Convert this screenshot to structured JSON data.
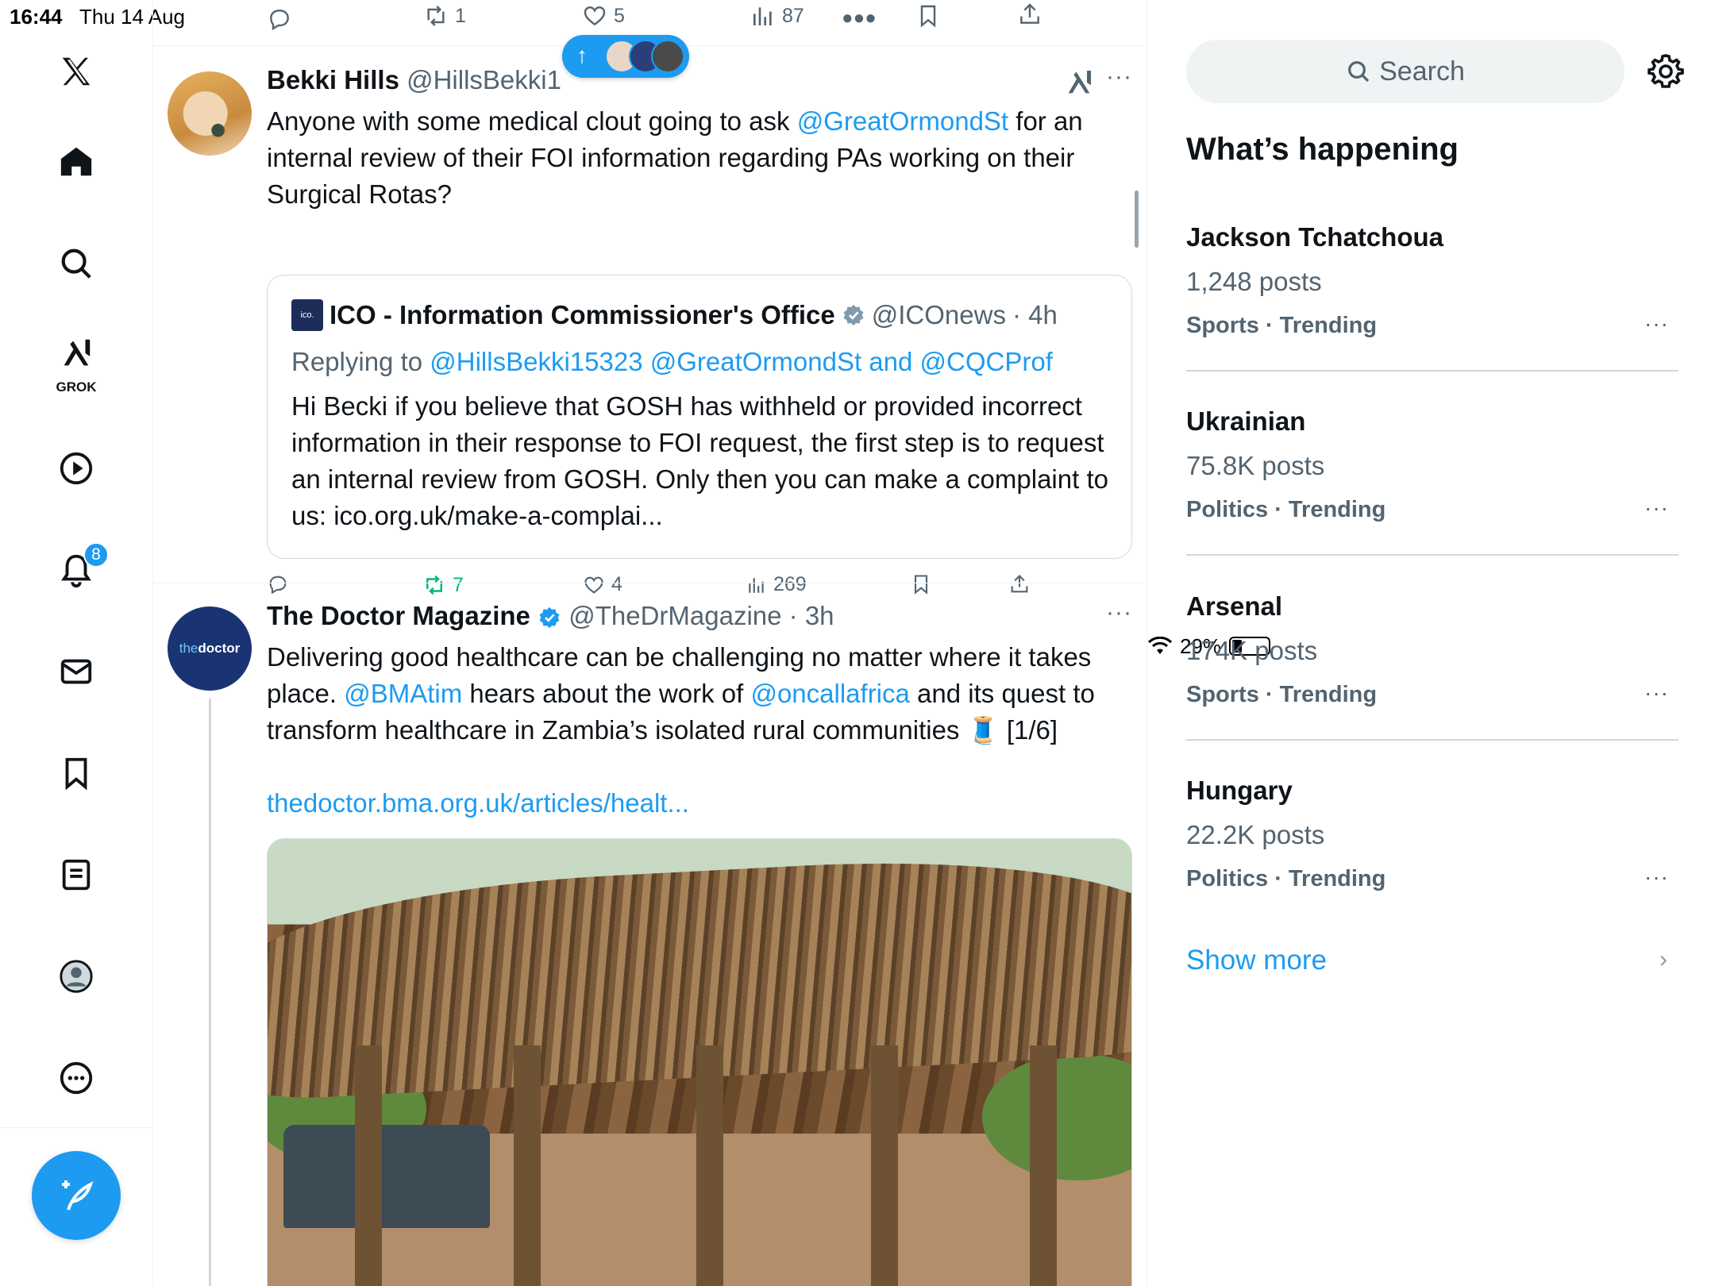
{
  "status": {
    "time": "16:44",
    "date": "Thu 14 Aug",
    "battery": "29%"
  },
  "nav": {
    "grok_label": "GROK",
    "notifications_badge": "8",
    "items": [
      "x-logo-icon",
      "home-icon",
      "search-icon",
      "grok-icon",
      "video-icon",
      "bell-icon",
      "mail-icon",
      "bookmark-icon",
      "lists-icon",
      "profile-icon",
      "more-icon"
    ]
  },
  "top_actions": {
    "retweets": "1",
    "likes": "5",
    "views": "87"
  },
  "tweet1": {
    "name": "Bekki Hills",
    "handle": "@HillsBekki1",
    "text_before": "Anyone with some medical clout going to ask ",
    "mention": "@GreatOrmondSt",
    "text_after": " for an internal review of their FOI information regarding PAs working on their Surgical Rotas?",
    "quote": {
      "logo": "ico.",
      "name": "ICO - Information Commissioner's Office",
      "handle": "@ICOnews",
      "time": "· 4h",
      "replying_prefix": "Replying to ",
      "replying_to": "@HillsBekki15323 @GreatOrmondSt and @CQCProf",
      "text": "Hi Becki if you believe that GOSH has withheld or provided incorrect information in their response to FOI request, the first step is to request an internal review from GOSH. Only then you can make a complaint to us: ico.org.uk/make-a-complai..."
    },
    "retweets": "7",
    "likes": "4",
    "views": "269"
  },
  "tweet2": {
    "avatar_the": "the",
    "avatar_doctor": "doctor",
    "name": "The Doctor Magazine",
    "handle": "@TheDrMagazine",
    "time": "· 3h",
    "t1": "Delivering good healthcare can be challenging no matter where it takes place. ",
    "m1": "@BMAtim",
    "t2": " hears about the work of ",
    "m2": "@oncallafrica",
    "t3": " and its quest to transform healthcare in Zambia’s isolated rural communities 🧵 [1/6]",
    "link": "thedoctor.bma.org.uk/articles/healt..."
  },
  "sidebar": {
    "search_placeholder": "Search",
    "heading": "What’s happening",
    "trends": [
      {
        "name": "Jackson Tchatchoua",
        "count": "1,248 posts",
        "tag": "Sports · Trending"
      },
      {
        "name": "Ukrainian",
        "count": "75.8K posts",
        "tag": "Politics · Trending"
      },
      {
        "name": "Arsenal",
        "count": "174K posts",
        "tag": "Sports · Trending"
      },
      {
        "name": "Hungary",
        "count": "22.2K posts",
        "tag": "Politics · Trending"
      }
    ],
    "show_more": "Show more"
  },
  "colors": {
    "accent": "#1d9bf0",
    "retweet_green": "#00ba7c",
    "text": "#0f1419",
    "muted": "#536471"
  }
}
